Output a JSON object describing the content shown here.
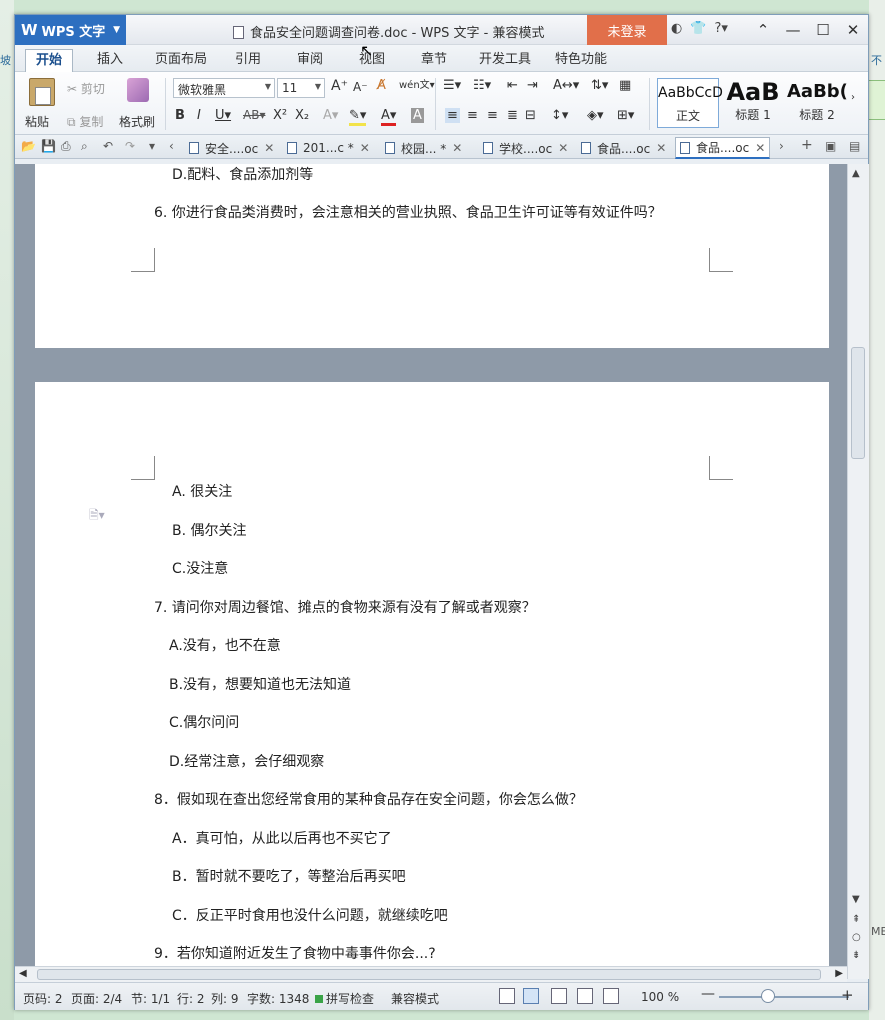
{
  "desktop": {
    "left_text": "坡",
    "right_top": "不",
    "right_bottom": "ME"
  },
  "app": {
    "name": "WPS 文字",
    "title": "食品安全问题调查问卷.doc - WPS 文字 - 兼容模式",
    "login": "未登录"
  },
  "menu": {
    "tabs": [
      "开始",
      "插入",
      "页面布局",
      "引用",
      "审阅",
      "视图",
      "章节",
      "开发工具",
      "特色功能"
    ],
    "active": "开始"
  },
  "ribbon": {
    "paste": "粘贴",
    "cut": "剪切",
    "copy": "复制",
    "format_painter": "格式刷",
    "font_name": "微软雅黑",
    "font_size": "11",
    "styles": [
      {
        "sample": "AaBbCcD",
        "label": "正文"
      },
      {
        "sample": "AaB",
        "label": "标题 1"
      },
      {
        "sample": "AaBb(",
        "label": "标题 2"
      }
    ]
  },
  "doc_tabs": [
    {
      "label": "安全....oc",
      "active": false
    },
    {
      "label": "201...c *",
      "active": false
    },
    {
      "label": "校园... *",
      "active": false
    },
    {
      "label": "学校....oc",
      "active": false
    },
    {
      "label": "食品....oc",
      "active": false
    },
    {
      "label": "食品....oc",
      "active": true
    }
  ],
  "document": {
    "page1": [
      "D.配料、食品添加剂等",
      "6. 你进行食品类消费时，会注意相关的营业执照、食品卫生许可证等有效证件吗？"
    ],
    "page2": [
      "A. 很关注",
      "B. 偶尔关注",
      "C.没注意",
      "7. 请问你对周边餐馆、摊点的食物来源有没有了解或者观察？",
      "A.没有，也不在意",
      "B.没有，想要知道也无法知道",
      "C.偶尔问问",
      "D.经常注意，会仔细观察",
      "8．假如现在查出您经常食用的某种食品存在安全问题，你会怎么做？",
      "A．真可怕，从此以后再也不买它了",
      "B．暂时就不要吃了，等整治后再买吧",
      "C．反正平时食用也没什么问题，就继续吃吧",
      "9．若你知道附近发生了食物中毒事件你会...?"
    ]
  },
  "status": {
    "page_code": "页码: 2",
    "page": "页面: 2/4",
    "section": "节: 1/1",
    "row": "行: 2",
    "col": "列: 9",
    "word_count": "字数: 1348",
    "spell": "拼写检查",
    "mode": "兼容模式",
    "zoom": "100 %"
  }
}
